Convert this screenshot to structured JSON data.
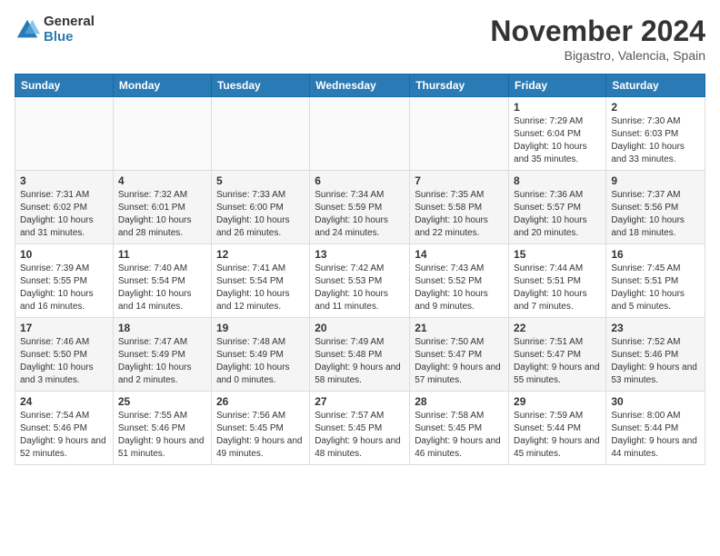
{
  "header": {
    "logo_general": "General",
    "logo_blue": "Blue",
    "month_title": "November 2024",
    "location": "Bigastro, Valencia, Spain"
  },
  "weekdays": [
    "Sunday",
    "Monday",
    "Tuesday",
    "Wednesday",
    "Thursday",
    "Friday",
    "Saturday"
  ],
  "weeks": [
    [
      {
        "day": "",
        "empty": true
      },
      {
        "day": "",
        "empty": true
      },
      {
        "day": "",
        "empty": true
      },
      {
        "day": "",
        "empty": true
      },
      {
        "day": "",
        "empty": true
      },
      {
        "day": "1",
        "sunrise": "7:29 AM",
        "sunset": "6:04 PM",
        "daylight": "10 hours and 35 minutes."
      },
      {
        "day": "2",
        "sunrise": "7:30 AM",
        "sunset": "6:03 PM",
        "daylight": "10 hours and 33 minutes."
      }
    ],
    [
      {
        "day": "3",
        "sunrise": "7:31 AM",
        "sunset": "6:02 PM",
        "daylight": "10 hours and 31 minutes."
      },
      {
        "day": "4",
        "sunrise": "7:32 AM",
        "sunset": "6:01 PM",
        "daylight": "10 hours and 28 minutes."
      },
      {
        "day": "5",
        "sunrise": "7:33 AM",
        "sunset": "6:00 PM",
        "daylight": "10 hours and 26 minutes."
      },
      {
        "day": "6",
        "sunrise": "7:34 AM",
        "sunset": "5:59 PM",
        "daylight": "10 hours and 24 minutes."
      },
      {
        "day": "7",
        "sunrise": "7:35 AM",
        "sunset": "5:58 PM",
        "daylight": "10 hours and 22 minutes."
      },
      {
        "day": "8",
        "sunrise": "7:36 AM",
        "sunset": "5:57 PM",
        "daylight": "10 hours and 20 minutes."
      },
      {
        "day": "9",
        "sunrise": "7:37 AM",
        "sunset": "5:56 PM",
        "daylight": "10 hours and 18 minutes."
      }
    ],
    [
      {
        "day": "10",
        "sunrise": "7:39 AM",
        "sunset": "5:55 PM",
        "daylight": "10 hours and 16 minutes."
      },
      {
        "day": "11",
        "sunrise": "7:40 AM",
        "sunset": "5:54 PM",
        "daylight": "10 hours and 14 minutes."
      },
      {
        "day": "12",
        "sunrise": "7:41 AM",
        "sunset": "5:54 PM",
        "daylight": "10 hours and 12 minutes."
      },
      {
        "day": "13",
        "sunrise": "7:42 AM",
        "sunset": "5:53 PM",
        "daylight": "10 hours and 11 minutes."
      },
      {
        "day": "14",
        "sunrise": "7:43 AM",
        "sunset": "5:52 PM",
        "daylight": "10 hours and 9 minutes."
      },
      {
        "day": "15",
        "sunrise": "7:44 AM",
        "sunset": "5:51 PM",
        "daylight": "10 hours and 7 minutes."
      },
      {
        "day": "16",
        "sunrise": "7:45 AM",
        "sunset": "5:51 PM",
        "daylight": "10 hours and 5 minutes."
      }
    ],
    [
      {
        "day": "17",
        "sunrise": "7:46 AM",
        "sunset": "5:50 PM",
        "daylight": "10 hours and 3 minutes."
      },
      {
        "day": "18",
        "sunrise": "7:47 AM",
        "sunset": "5:49 PM",
        "daylight": "10 hours and 2 minutes."
      },
      {
        "day": "19",
        "sunrise": "7:48 AM",
        "sunset": "5:49 PM",
        "daylight": "10 hours and 0 minutes."
      },
      {
        "day": "20",
        "sunrise": "7:49 AM",
        "sunset": "5:48 PM",
        "daylight": "9 hours and 58 minutes."
      },
      {
        "day": "21",
        "sunrise": "7:50 AM",
        "sunset": "5:47 PM",
        "daylight": "9 hours and 57 minutes."
      },
      {
        "day": "22",
        "sunrise": "7:51 AM",
        "sunset": "5:47 PM",
        "daylight": "9 hours and 55 minutes."
      },
      {
        "day": "23",
        "sunrise": "7:52 AM",
        "sunset": "5:46 PM",
        "daylight": "9 hours and 53 minutes."
      }
    ],
    [
      {
        "day": "24",
        "sunrise": "7:54 AM",
        "sunset": "5:46 PM",
        "daylight": "9 hours and 52 minutes."
      },
      {
        "day": "25",
        "sunrise": "7:55 AM",
        "sunset": "5:46 PM",
        "daylight": "9 hours and 51 minutes."
      },
      {
        "day": "26",
        "sunrise": "7:56 AM",
        "sunset": "5:45 PM",
        "daylight": "9 hours and 49 minutes."
      },
      {
        "day": "27",
        "sunrise": "7:57 AM",
        "sunset": "5:45 PM",
        "daylight": "9 hours and 48 minutes."
      },
      {
        "day": "28",
        "sunrise": "7:58 AM",
        "sunset": "5:45 PM",
        "daylight": "9 hours and 46 minutes."
      },
      {
        "day": "29",
        "sunrise": "7:59 AM",
        "sunset": "5:44 PM",
        "daylight": "9 hours and 45 minutes."
      },
      {
        "day": "30",
        "sunrise": "8:00 AM",
        "sunset": "5:44 PM",
        "daylight": "9 hours and 44 minutes."
      }
    ]
  ]
}
